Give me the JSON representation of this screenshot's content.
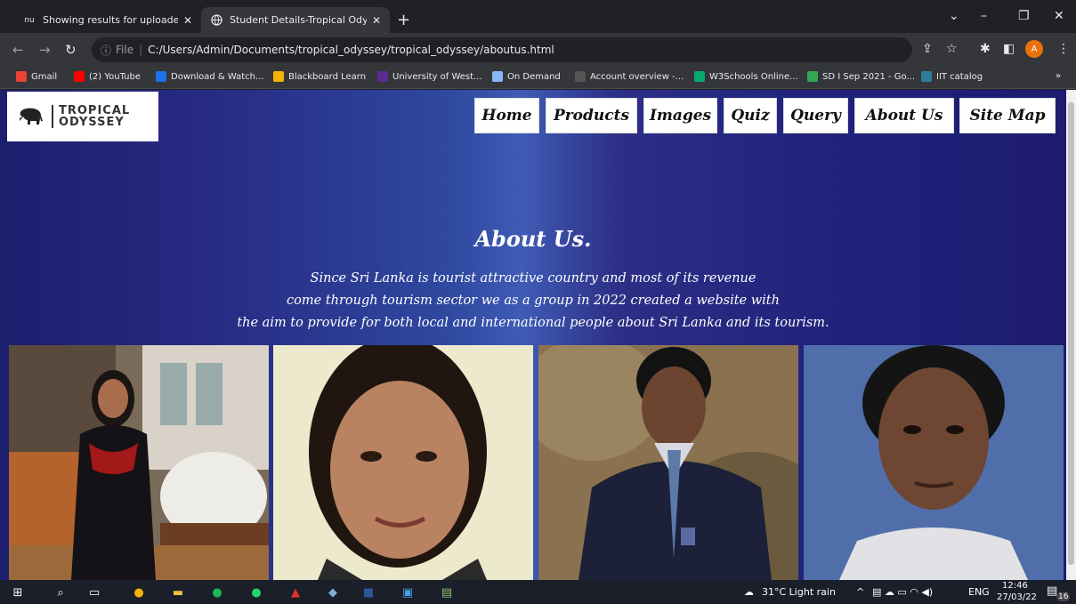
{
  "browser": {
    "tabs": [
      {
        "label": "Showing results for uploaded file",
        "favicon": "nu"
      },
      {
        "label": "Student Details-Tropical Odyssey",
        "favicon": "globe-icon"
      }
    ],
    "address": {
      "scheme_label": "File",
      "url": "C:/Users/Admin/Documents/tropical_odyssey/tropical_odyssey/aboutus.html"
    },
    "profile_initial": "A",
    "bookmarks": [
      {
        "label": "Gmail",
        "color": "#ea4335"
      },
      {
        "label": "(2) YouTube",
        "color": "#ff0000"
      },
      {
        "label": "Download & Watch...",
        "color": "#1a73e8"
      },
      {
        "label": "Blackboard Learn",
        "color": "#f4b400"
      },
      {
        "label": "University of West...",
        "color": "#5c2d91"
      },
      {
        "label": "On Demand",
        "color": "#8ab4f8"
      },
      {
        "label": "Account overview -...",
        "color": "#555555"
      },
      {
        "label": "W3Schools Online...",
        "color": "#04aa6d"
      },
      {
        "label": "SD I Sep 2021 - Go...",
        "color": "#34a853"
      },
      {
        "label": "IIT catalog",
        "color": "#2d7d9a"
      }
    ]
  },
  "site": {
    "logo": {
      "line1": "TROPICAL",
      "line2": "ODYSSEY"
    },
    "nav": [
      "Home",
      "Products",
      "Images",
      "Quiz",
      "Query",
      "About Us",
      "Site Map"
    ],
    "hero": {
      "title": "About Us.",
      "lines": [
        "Since Sri Lanka is tourist attractive country and most of its revenue",
        "come through tourism sector we as a group in 2022 created a website with",
        "the aim to provide for both local and international people about Sri Lanka and its tourism."
      ]
    },
    "photos": [
      "team-member-photo-1",
      "team-member-photo-2",
      "team-member-photo-3",
      "team-member-photo-4"
    ]
  },
  "taskbar": {
    "weather": "31°C  Light rain",
    "language": "ENG",
    "time": "12:46",
    "date": "27/03/22",
    "notifications": "16"
  }
}
